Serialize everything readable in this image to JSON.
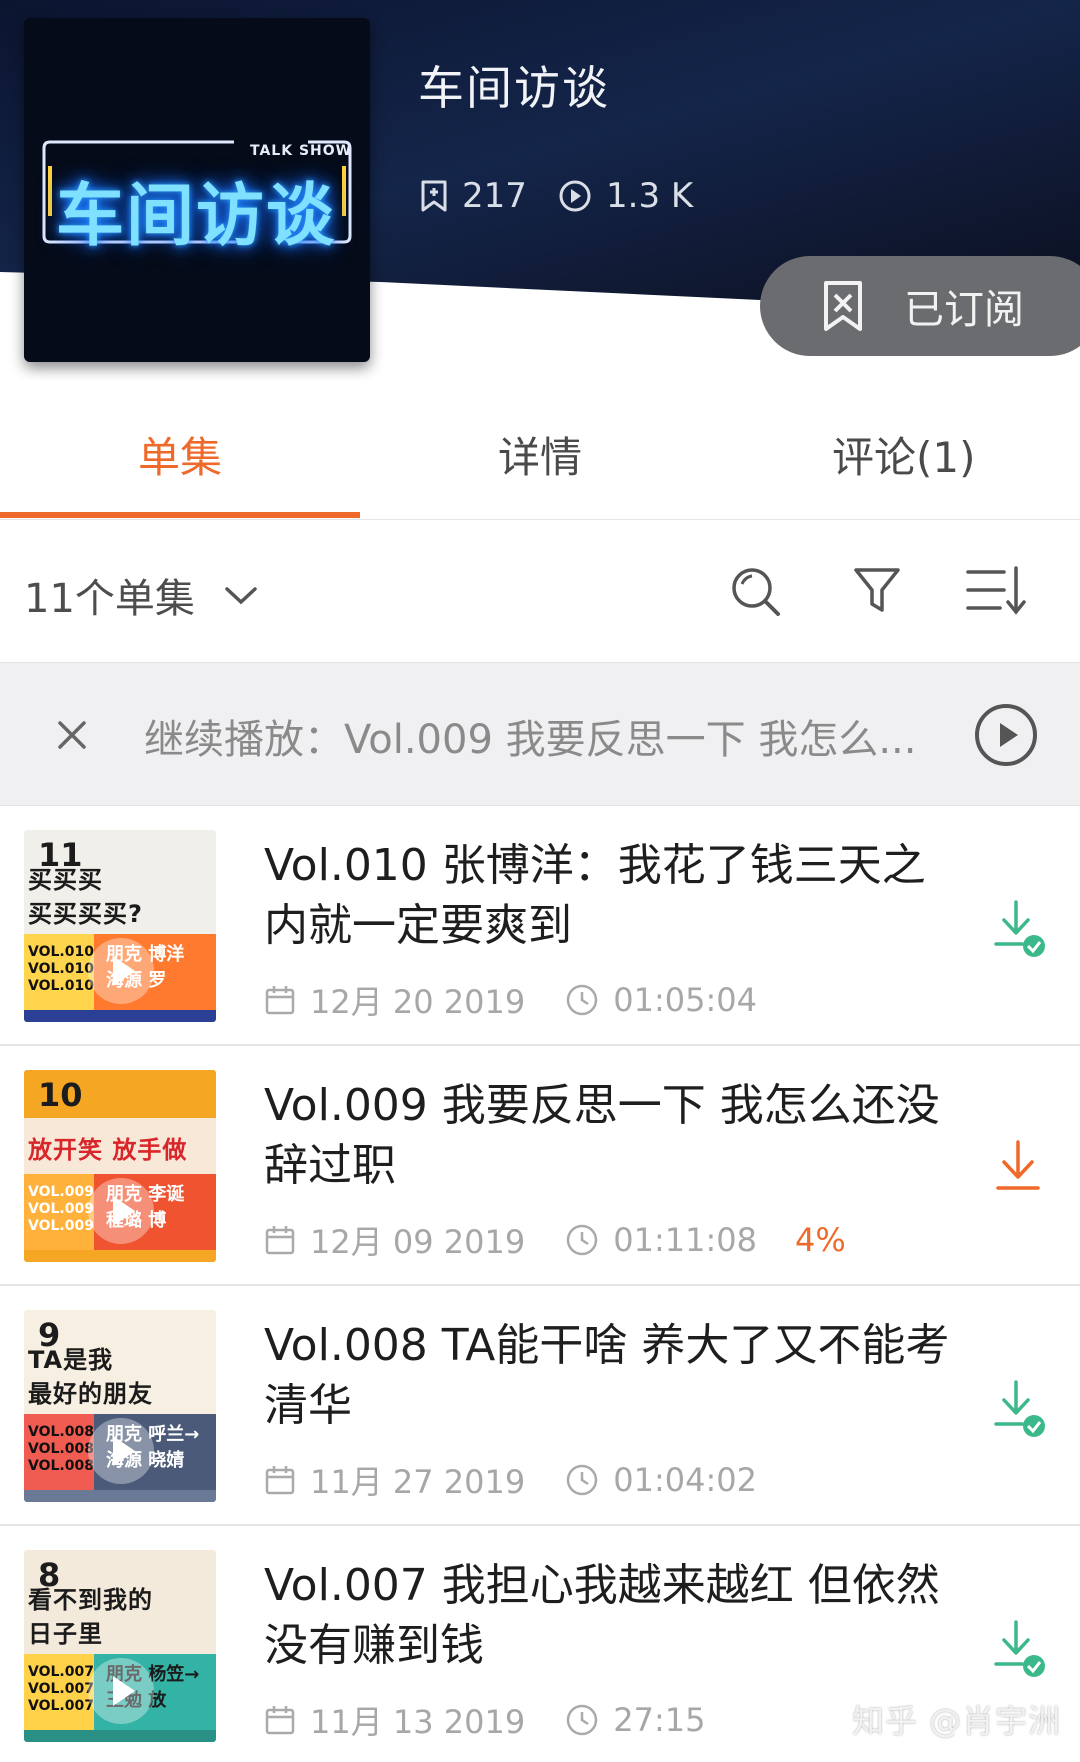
{
  "podcast": {
    "title": "车间访谈",
    "cover_title": "车间访谈",
    "cover_tagline": "TALK SHOW",
    "favorites": "217",
    "plays": "1.3 K",
    "subscribe_label": "已订阅"
  },
  "tabs": [
    {
      "label": "单集",
      "active": true
    },
    {
      "label": "详情",
      "active": false
    },
    {
      "label": "评论(1)",
      "active": false
    }
  ],
  "toolbar": {
    "episode_count": "11个单集",
    "icons": [
      "search-icon",
      "filter-icon",
      "sort-icon"
    ]
  },
  "continue_bar": {
    "text": "继续播放：Vol.009 我要反思一下 我怎么..."
  },
  "episodes": [
    {
      "title": "Vol.010 张博洋：我花了钱三天之内就一定要爽到",
      "date": "12月 20 2019",
      "duration": "01:05:04",
      "progress": "",
      "downloaded": true,
      "thumb": {
        "number": "11",
        "line1": "买买买",
        "line2": "买买买买?",
        "vol": "VOL.010",
        "name1": "朋克 博洋",
        "name2": "海源 罗"
      }
    },
    {
      "title": "Vol.009 我要反思一下 我怎么还没辞过职",
      "date": "12月 09 2019",
      "duration": "01:11:08",
      "progress": "4%",
      "downloaded": false,
      "thumb": {
        "number": "10",
        "line1": "放开笑 放手做",
        "line2": "",
        "vol": "VOL.009",
        "name1": "朋克 李诞",
        "name2": "程璐 博"
      }
    },
    {
      "title": "Vol.008 TA能干啥 养大了又不能考清华",
      "date": "11月 27 2019",
      "duration": "01:04:02",
      "progress": "",
      "downloaded": true,
      "thumb": {
        "number": "9",
        "line1": "TA是我",
        "line2": "最好的朋友",
        "vol": "VOL.008",
        "name1": "朋克 呼兰→",
        "name2": "海源 晓婧"
      }
    },
    {
      "title": "Vol.007 我担心我越来越红 但依然没有赚到钱",
      "date": "11月 13 2019",
      "duration": "27:15",
      "progress": "",
      "downloaded": true,
      "thumb": {
        "number": "8",
        "line1": "看不到我的",
        "line2": "日子里",
        "vol": "VOL.007",
        "name1": "朋克 杨笠→",
        "name2": "王勉 放"
      }
    }
  ],
  "watermark": "知乎 @肖宇洲",
  "colors": {
    "accent": "#ef6a2a",
    "header_bg": "#0f1d3a",
    "download_done": "#3cb98a",
    "subscribe_bg": "#6b6c6f"
  }
}
